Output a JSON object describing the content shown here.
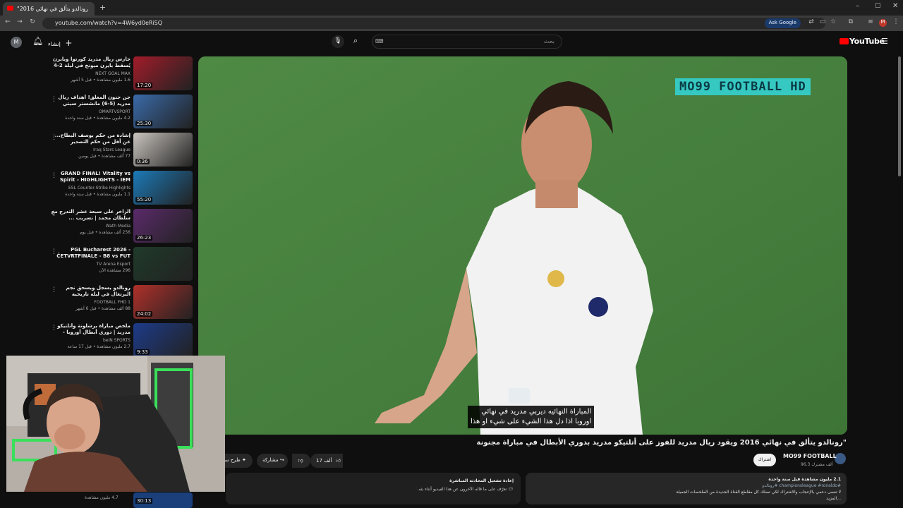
{
  "browser": {
    "tab_title": "\"رونالدو يتألق في نهائي 2016",
    "url": "youtube.com/watch?v=4W6yd0eRiSQ",
    "ask_google": "Ask Google"
  },
  "header": {
    "create_label": "إنشاء",
    "search_placeholder": "بحث",
    "logo": "YouTube",
    "avatar_letter": "M",
    "notif_badge": "9+"
  },
  "recommendations": [
    {
      "title": "حارس ريال مدريد كورتوا وبايرن يُسقط بايرن ميونخ في ليلة 2-4 التاريخية",
      "channel": "NEXT GOAL MAX",
      "stats": "1.6 مليون مشاهدة • قبل 5 أشهر",
      "duration": "17:20",
      "color": "#a11c2a"
    },
    {
      "title": "جن جنون المعلق! أهداف ريال مدريد (5-6) مانشستر سيتي ريمونتادا ...",
      "channel": "OMARTVSPORT",
      "stats": "4.2 مليون مشاهدة • قبل سنة واحدة",
      "duration": "25:30",
      "color": "#3a6aa8"
    },
    {
      "title": "إشادة من حكم يوسف البطاح... عن أقل من حكم التصدير السعودي ...",
      "channel": "Iraq Stars League",
      "stats": "77 ألف مشاهدة • قبل يومين",
      "duration": "0:36",
      "color": "#c9c4be"
    },
    {
      "title": "GRAND FINAL! Vitality vs Spirit - HIGHLIGHTS - IEM Katowice",
      "channel": "ESL Counter-Strike Highlights",
      "stats": "1.1 مليون مشاهدة • قبل سنة واحدة",
      "duration": "55:20",
      "color": "#1c7ab8"
    },
    {
      "title": "الزاخر على سبعة عشر التدرج مع سلطان محمد | تسريب ...",
      "channel": "Wath Media",
      "stats": "256 ألف مشاهدة • قبل يوم",
      "duration": "26:23",
      "color": "#5a2a6a"
    },
    {
      "title": "PGL Bucharest 2026 - ČETVRTFINALE - B8 vs FUT",
      "channel": "TV Arena Esport",
      "stats": "296 مشاهدة الآن",
      "duration": "",
      "color": "#1f3a2a"
    },
    {
      "title": "رونالدو يسجل ويسحق نجم البرتغال في ليلة تاريخية",
      "channel": "FOOTBALL FHD 1",
      "stats": "88 ألف مشاهدة • قبل 6 أشهر",
      "duration": "24:02",
      "color": "#b0302a"
    },
    {
      "title": "ملخص مباراة برشلونة وأتلتيكو مدريد | دوري أبطال أوروبا - ذهاب الدور ربع ...",
      "channel": "beIN SPORTS",
      "stats": "2.7 مليون مشاهدة • قبل 17 ساعة",
      "duration": "9:33",
      "color": "#1d3b8a"
    }
  ],
  "video": {
    "watermark": "MO99 FOOTBALL HD",
    "subtitle_line1": "المباراة النهائيه ديربي مدريد في نهائي",
    "subtitle_line2": "اوروبا اذا دل هذا الشيء على شيء او هذا",
    "title": "\"رونالدو يتألق في نهائي 2016 ويقود ريال مدريد للفوز على أتلتيكو مدريد بدوري الأبطال في مباراة مجنونة"
  },
  "actions": {
    "likes": "17 ألف",
    "share": "مشاركة",
    "ask": "طرح سؤال",
    "channel": "MO99 FOOTBALL",
    "subscribers": "96.3 ألف مشترك",
    "subscribe": "اشتراك"
  },
  "description": {
    "stats": "2.1 مليون مشاهدة  قبل سنة واحدة",
    "tags": "#championsleague  #ronaldo  #رونالدو",
    "text": "لا تنسى دعمي بالإعجاب والاشتراك لكي تصلك كل مقاطع القناة الجديدة من الملخصات الجميلة",
    "more": "...المزيد"
  },
  "chat": {
    "title": "إعادة تشغيل المحادثة المباشرة",
    "subtitle": "تعرّف على ما قاله الآخرون عن هذا الفيديو أثناء بثه."
  },
  "bottom_rec": {
    "duration": "30:13",
    "stats": "4.7 مليون مشاهدة"
  }
}
